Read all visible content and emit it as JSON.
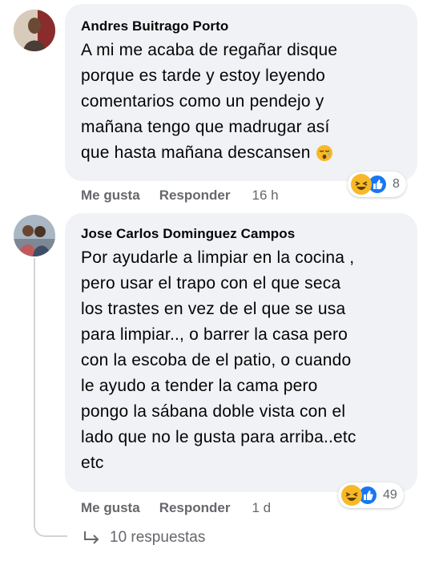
{
  "comments": [
    {
      "author": "Andres Buitrago Porto",
      "text_lines": [
        "A mi me acaba de regañar disque",
        "porque es tarde y estoy leyendo",
        "comentarios como un pendejo y",
        "mañana tengo que madrugar así",
        "que hasta mañana descansen"
      ],
      "trailing_emoji": "sleepy-face-emoji",
      "like_label": "Me gusta",
      "reply_label": "Responder",
      "time": "16 h",
      "reactions": [
        "haha",
        "like"
      ],
      "reaction_count": "8"
    },
    {
      "author": "Jose Carlos Dominguez Campos",
      "text_lines": [
        "Por ayudarle a limpiar en la cocina ,",
        "pero usar el trapo con el que seca",
        "los trastes en vez de el que se usa",
        "para limpiar.., o barrer la casa pero",
        "con la escoba de el patio, o cuando",
        "le ayudo a tender la cama pero",
        "pongo la sábana doble vista con el",
        "lado que no le gusta para arriba..etc",
        "etc"
      ],
      "like_label": "Me gusta",
      "reply_label": "Responder",
      "time": "1 d",
      "reactions": [
        "haha",
        "like"
      ],
      "reaction_count": "49",
      "replies_label": "10 respuestas"
    }
  ],
  "colors": {
    "bubble": "#f0f2f5",
    "secondary_text": "#65676b",
    "like_blue": "#1877f2",
    "haha_yellow": "#f7b928"
  }
}
